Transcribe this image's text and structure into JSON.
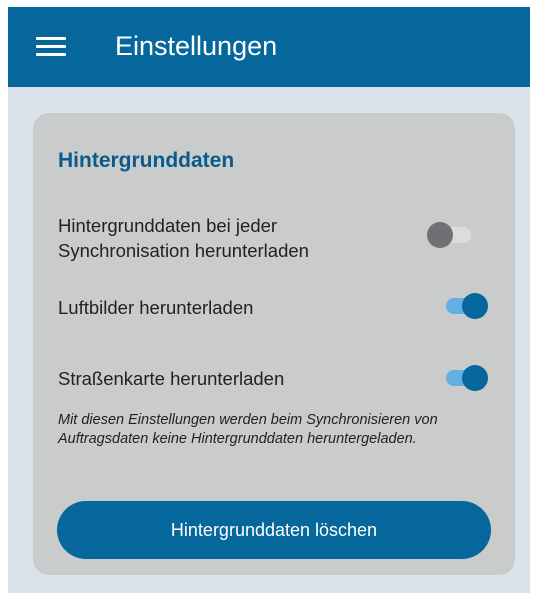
{
  "app_bar": {
    "title": "Einstellungen",
    "menu_icon": "menu-icon",
    "background_color": "#05679b"
  },
  "card": {
    "section_title": "Hintergrunddaten",
    "settings": [
      {
        "label": "Hintergrunddaten bei jeder Synchronisation herunterladen",
        "enabled": false
      },
      {
        "label": "Luftbilder herunterladen",
        "enabled": true
      },
      {
        "label": "Straßenkarte herunterladen",
        "enabled": true
      }
    ],
    "note": "Mit diesen Einstellungen werden beim Synchronisieren von Auftragsdaten keine Hintergrunddaten heruntergeladen.",
    "button_label": "Hintergrunddaten löschen"
  },
  "colors": {
    "accent": "#05679b",
    "switch_on_track": "#63aee3",
    "switch_off_thumb": "#6f7073",
    "card_background": "#c9ccca",
    "section_title": "#0b5a8e"
  }
}
